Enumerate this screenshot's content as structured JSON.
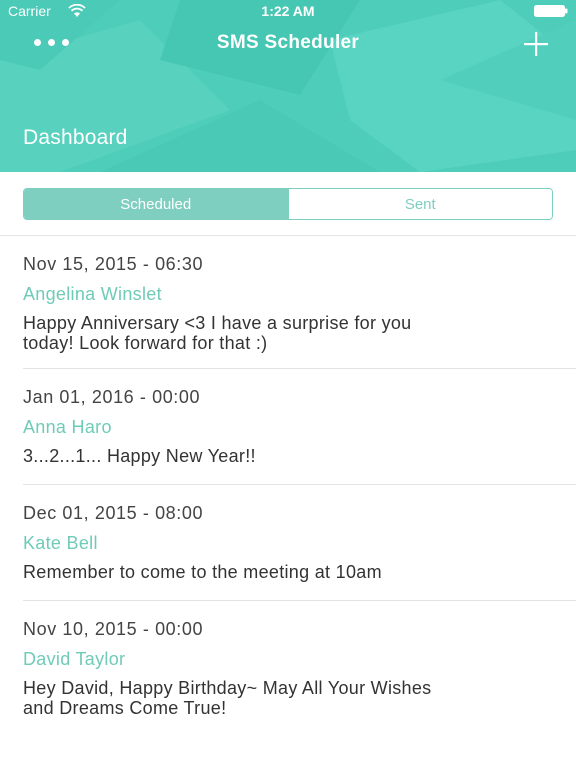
{
  "status_bar": {
    "carrier": "Carrier",
    "time": "1:22 AM",
    "icons": [
      "wifi-icon",
      "battery-icon"
    ]
  },
  "nav": {
    "title": "SMS Scheduler",
    "left_icon": "more-icon",
    "right_icon": "plus-icon"
  },
  "header": {
    "section_title": "Dashboard"
  },
  "segments": {
    "scheduled": "Scheduled",
    "sent": "Sent",
    "selected": "Scheduled"
  },
  "messages": [
    {
      "date": "Nov 15, 2015 - 06:30",
      "name": "Angelina Winslet",
      "line1": "Happy Anniversary <3 I have a surprise for you",
      "line2": "today! Look forward for that :)"
    },
    {
      "date": "Jan 01, 2016 - 00:00",
      "name": "Anna Haro",
      "line1": "3...2...1... Happy New Year!!",
      "line2": ""
    },
    {
      "date": "Dec 01, 2015 - 08:00",
      "name": "Kate Bell",
      "line1": "Remember to come to the meeting at 10am",
      "line2": ""
    },
    {
      "date": "Nov 10, 2015 - 00:00",
      "name": "David Taylor",
      "line1": "Hey David, Happy Birthday~ May All Your Wishes",
      "line2": "and Dreams Come True!"
    }
  ],
  "colors": {
    "header": "#4ecdba",
    "accent": "#7ecfc0",
    "contact_name": "#6fcbb8"
  }
}
